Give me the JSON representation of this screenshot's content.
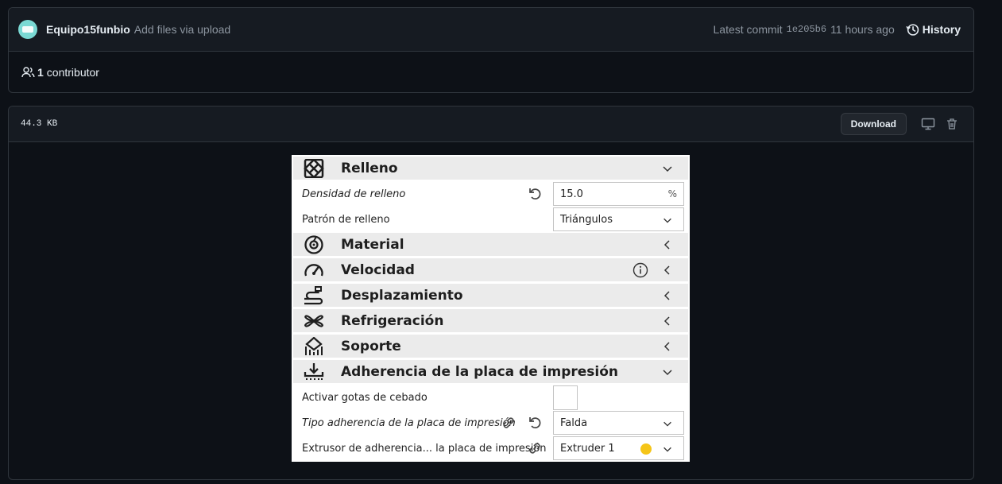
{
  "commit": {
    "author": "Equipo15funbio",
    "message": "Add files via upload",
    "latest_label": "Latest commit",
    "sha": "1e205b6",
    "time_ago": "11 hours ago",
    "history_label": "History"
  },
  "contributors": {
    "count": "1",
    "label": "contributor"
  },
  "file": {
    "size": "44.3 KB",
    "download_label": "Download"
  },
  "cura": {
    "categories": {
      "relleno": "Relleno",
      "material": "Material",
      "velocidad": "Velocidad",
      "desplazamiento": "Desplazamiento",
      "refrigeracion": "Refrigeración",
      "soporte": "Soporte",
      "adherencia": "Adherencia de la placa de impresión"
    },
    "settings": {
      "densidad_label": "Densidad de relleno",
      "densidad_value": "15.0",
      "densidad_unit": "%",
      "patron_label": "Patrón de relleno",
      "patron_value": "Triángulos",
      "gotas_label": "Activar gotas de cebado",
      "tipo_label": "Tipo adherencia de la placa de impresión",
      "tipo_value": "Falda",
      "extrusor_label": "Extrusor de adherencia... la placa de impresión",
      "extrusor_value": "Extruder 1"
    },
    "colors": {
      "extruder_dot": "#f5c518"
    }
  }
}
